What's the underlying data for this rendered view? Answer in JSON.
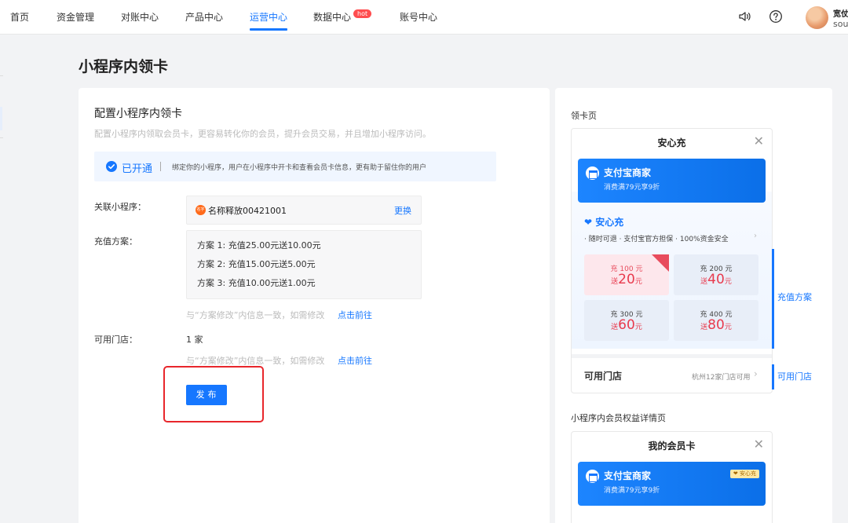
{
  "topbar": {
    "nav": [
      {
        "label": "首页",
        "active": false
      },
      {
        "label": "资金管理",
        "active": false
      },
      {
        "label": "对账中心",
        "active": false
      },
      {
        "label": "产品中心",
        "active": false
      },
      {
        "label": "运营中心",
        "active": true
      },
      {
        "label": "数据中心",
        "active": false,
        "badge": "hot"
      },
      {
        "label": "账号中心",
        "active": false
      }
    ],
    "user": {
      "name": "宽仗",
      "sub": "sou"
    }
  },
  "page": {
    "title": "小程序内领卡"
  },
  "config": {
    "title": "配置小程序内领卡",
    "desc": "配置小程序内领取会员卡，更容易转化你的会员，提升会员交易，并且增加小程序访问。",
    "status_label": "已开通",
    "status_desc": "绑定你的小程序，用户在小程序中开卡和查看会员卡信息，更有助于留住你的用户",
    "mini_label": "关联小程序：",
    "mini_logo": "名字",
    "mini_name": "名称释放00421001",
    "change_link": "更换",
    "plan_label": "充值方案：",
    "plans": [
      "方案 1:  充值25.00元送10.00元",
      "方案 2:  充值15.00元送5.00元",
      "方案 3:  充值10.00元送1.00元"
    ],
    "plan_hint": "与“方案修改”内信息一致，如需修改",
    "plan_link": "点击前往",
    "store_label": "可用门店：",
    "store_value": "1 家",
    "store_hint": "与“方案修改”内信息一致，如需修改",
    "store_link": "点击前往",
    "publish": "发布"
  },
  "preview": {
    "card_page_label": "领卡页",
    "phone1": {
      "title": "安心充",
      "banner_title": "支付宝商家",
      "banner_sub": "消费满79元享9折",
      "anxin": "安心充",
      "features": "· 随时可退   · 支付宝官方担保   · 100%资金安全",
      "tiles": [
        {
          "top": "充 100 元",
          "give": "送",
          "amount": "20",
          "unit": "元"
        },
        {
          "top": "充 200 元",
          "give": "送",
          "amount": "40",
          "unit": "元"
        },
        {
          "top": "充 300 元",
          "give": "送",
          "amount": "60",
          "unit": "元"
        },
        {
          "top": "充 400 元",
          "give": "送",
          "amount": "80",
          "unit": "元"
        }
      ],
      "plan_tag": "充值方案",
      "store_row": "可用门店",
      "store_row_right": "杭州12家门店可用",
      "store_tag": "可用门店"
    },
    "detail_label": "小程序内会员权益详情页",
    "phone2": {
      "title": "我的会员卡",
      "banner_title": "支付宝商家",
      "banner_sub": "消费满79元享9折",
      "vip_badge": "安心充"
    }
  },
  "colors": {
    "accent": "#1677ff",
    "danger": "#e8262b",
    "hot": "#ff4d4f"
  }
}
